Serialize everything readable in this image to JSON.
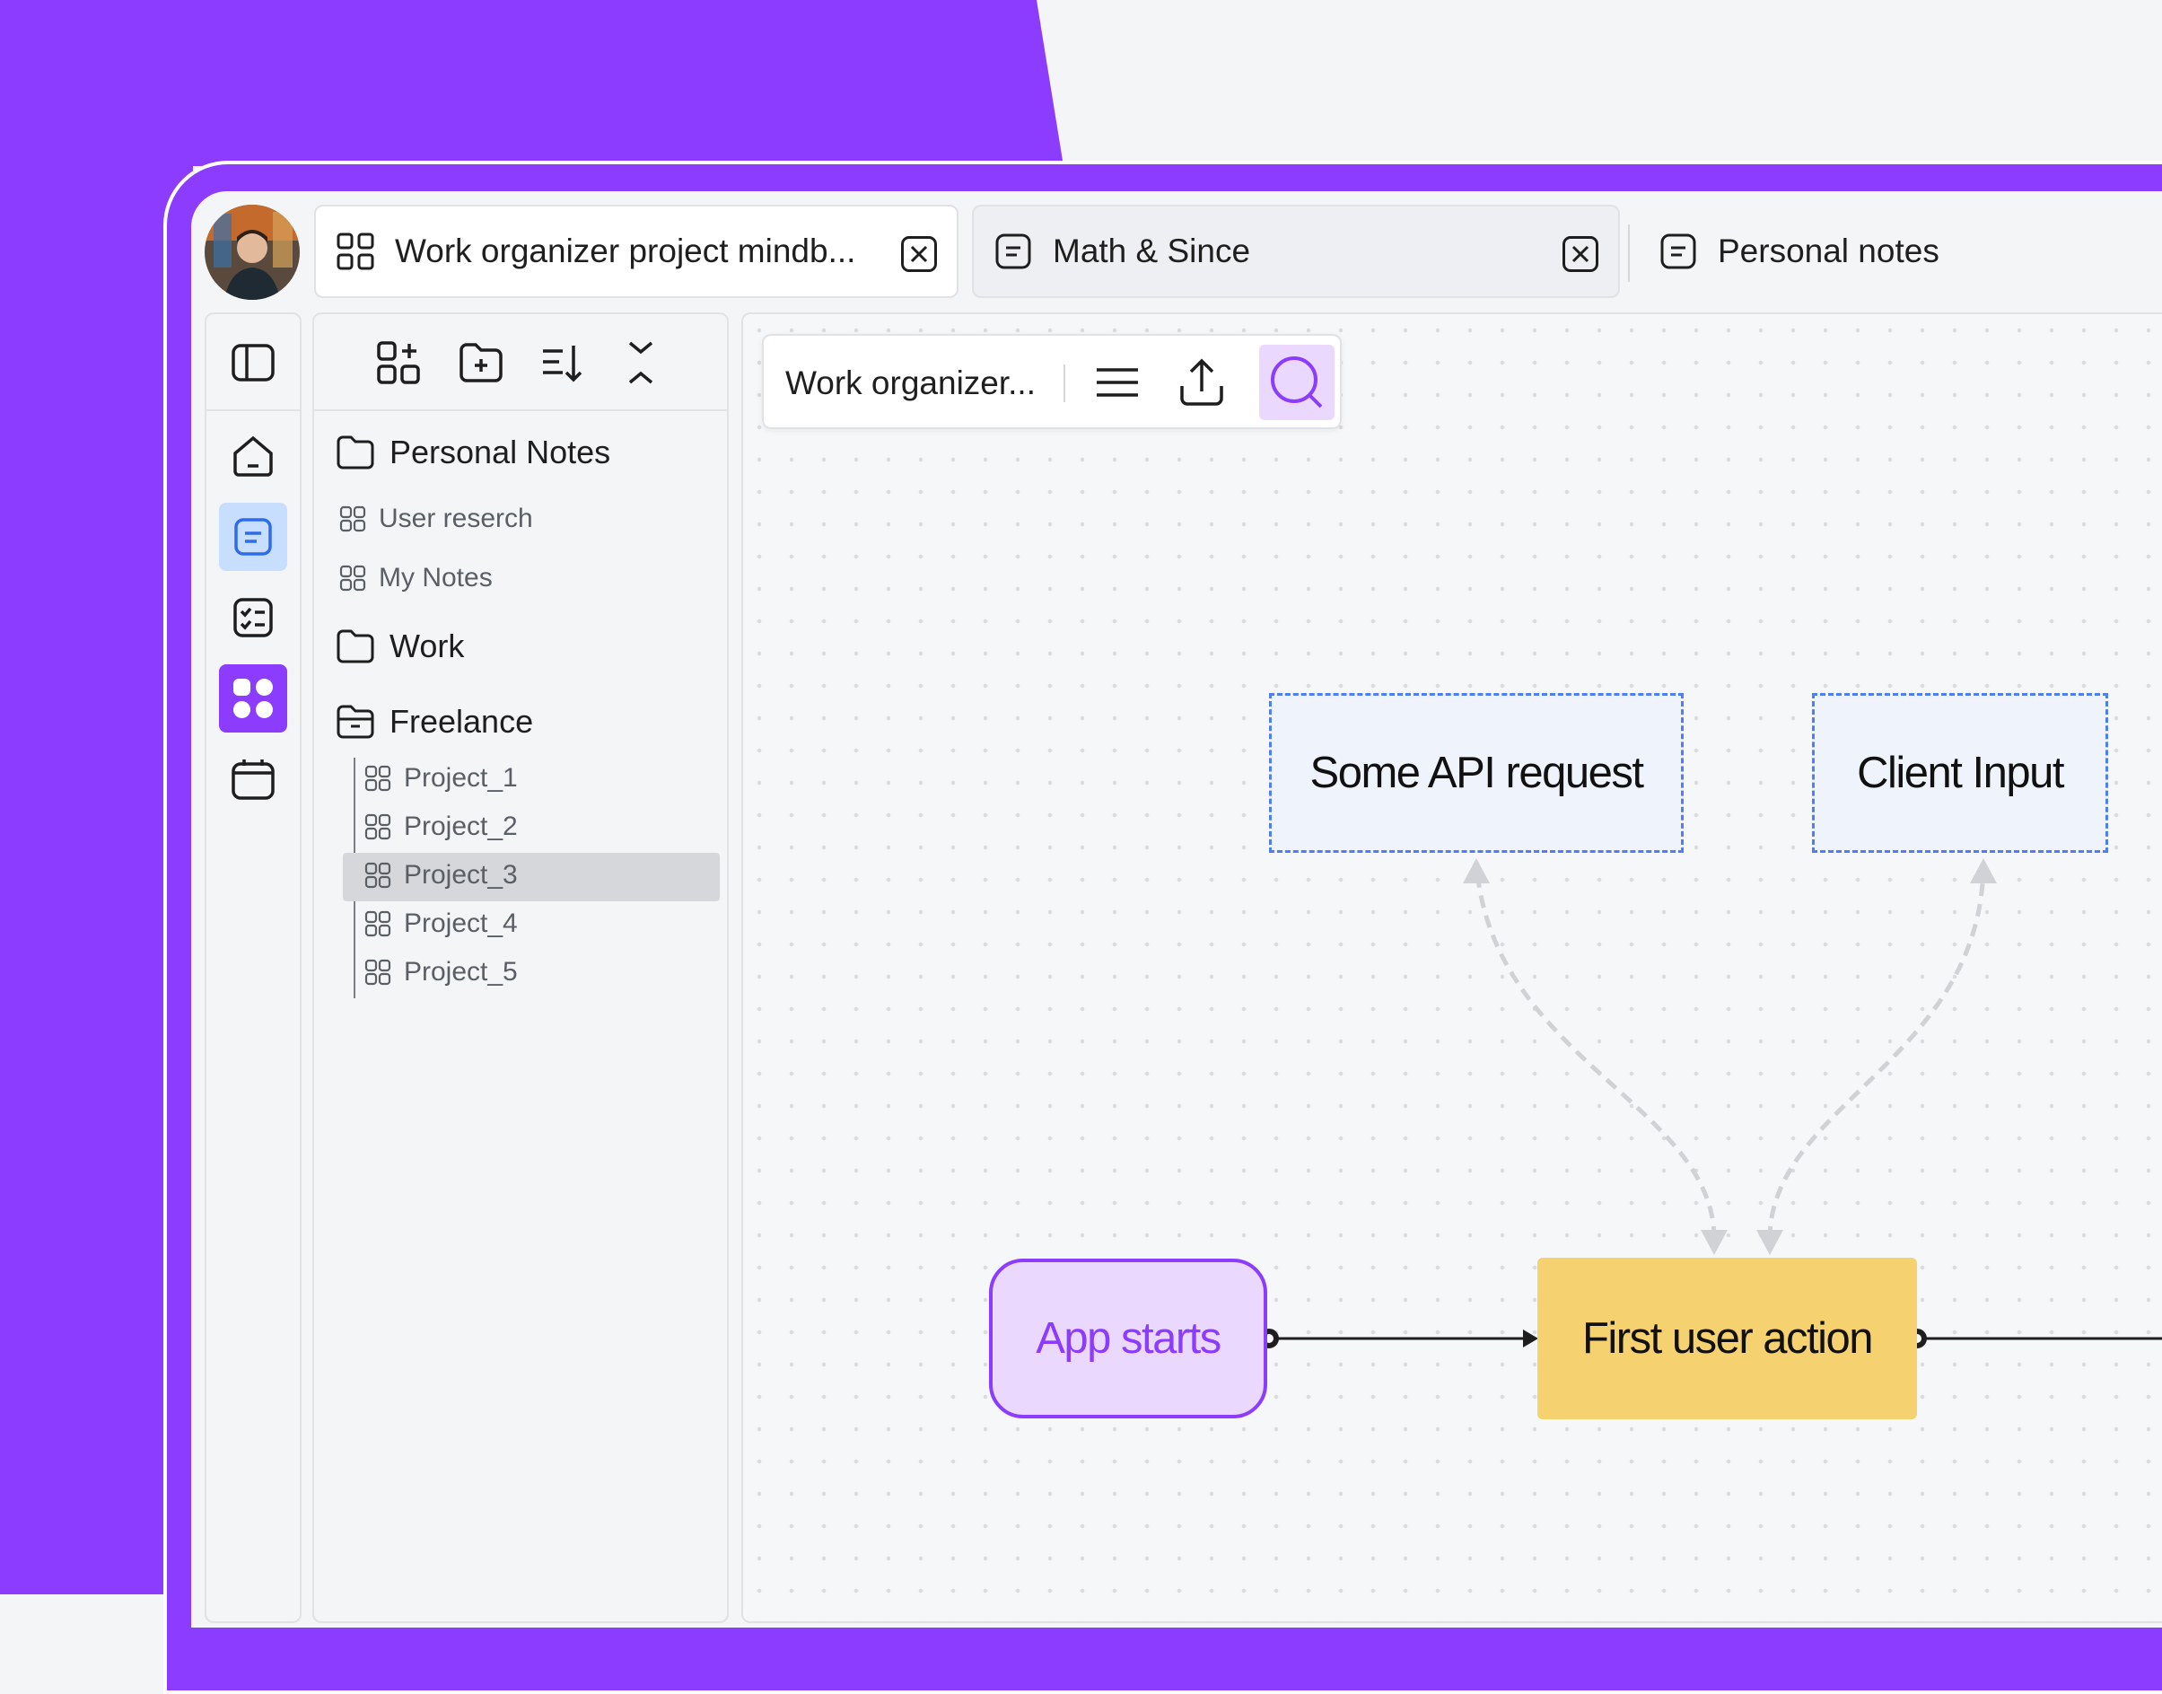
{
  "colors": {
    "brand_purple": "#8B3CFF",
    "canvas_bg": "#F6F7F9",
    "active_rail": "#C7DEFF",
    "search_bg": "#EBD8FF",
    "action_node": "#F6D170",
    "dashed_border": "#4F7DF3"
  },
  "tabs": [
    {
      "label": "Work organizer project mindb...",
      "icon": "grid-icon",
      "closable": true,
      "active": true
    },
    {
      "label": "Math & Since",
      "icon": "note-icon",
      "closable": true,
      "active": false
    },
    {
      "label": "Personal notes",
      "icon": "note-icon",
      "closable": false,
      "active": false
    }
  ],
  "rail": {
    "items": [
      "sidebar-toggle-icon",
      "home-icon",
      "notes-icon",
      "checklist-icon",
      "apps-icon",
      "calendar-icon"
    ]
  },
  "tree": {
    "toolbar": [
      "add-board-icon",
      "add-folder-icon",
      "sort-icon",
      "collapse-icon"
    ],
    "personal": {
      "label": "Personal Notes",
      "children": [
        "User reserch",
        "My Notes"
      ]
    },
    "work": {
      "label": "Work"
    },
    "freelance": {
      "label": "Freelance",
      "children": [
        "Project_1",
        "Project_2",
        "Project_3",
        "Project_4",
        "Project_5"
      ],
      "selected": "Project_3"
    }
  },
  "canvas": {
    "title": "Work organizer...",
    "toolbar": [
      "menu-icon",
      "upload-icon",
      "search-icon"
    ],
    "nodes": {
      "api": "Some API request",
      "client": "Client Input",
      "start": "App starts",
      "action": "First user action"
    }
  }
}
